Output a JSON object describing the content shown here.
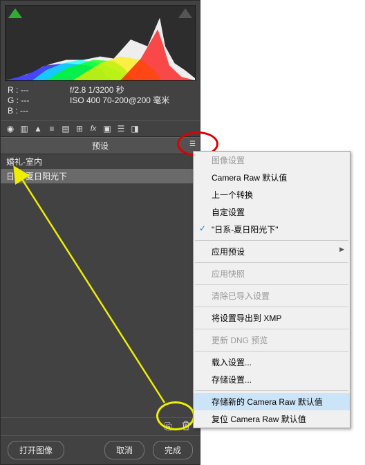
{
  "histogram": {
    "meta": {
      "r_label": "R :",
      "g_label": "G :",
      "b_label": "B :",
      "r_val": "---",
      "g_val": "---",
      "b_val": "---",
      "fline": "f/2.8   1/3200 秒",
      "isoline": "ISO 400   70-200@200 毫米"
    }
  },
  "section_title": "预设",
  "presets": {
    "item0": "婚礼-室内",
    "item1": "日系-夏日阳光下"
  },
  "buttons": {
    "open": "打开图像",
    "cancel": "取消",
    "done": "完成"
  },
  "menu": {
    "image_settings": "图像设置",
    "raw_default": "Camera Raw 默认值",
    "prev_convert": "上一个转换",
    "custom": "自定设置",
    "current_preset": "\"日系-夏日阳光下\"",
    "apply_preset": "应用预设",
    "apply_snapshot": "应用快照",
    "clear_import": "清除已导入设置",
    "export_xmp": "将设置导出到 XMP",
    "update_dng": "更新 DNG 预览",
    "load_settings": "载入设置...",
    "save_settings": "存储设置...",
    "save_new_default": "存储新的 Camera Raw 默认值",
    "reset_default": "复位 Camera Raw 默认值"
  }
}
